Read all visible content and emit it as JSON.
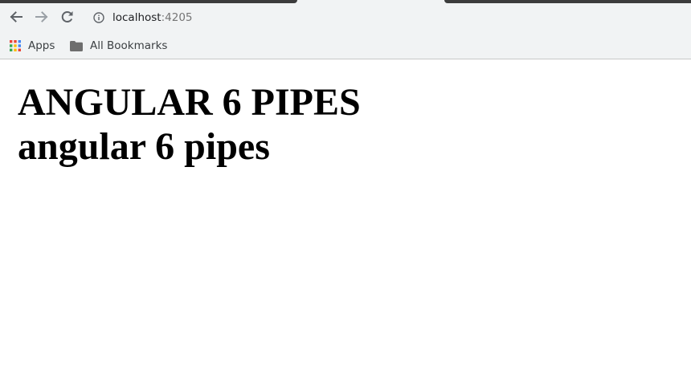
{
  "browser": {
    "url_host": "localhost",
    "url_port": ":4205",
    "bookmarks": {
      "apps_label": "Apps",
      "all_bookmarks_label": "All Bookmarks"
    }
  },
  "page": {
    "heading_upper": "ANGULAR 6 PIPES",
    "heading_lower": "angular 6 pipes"
  },
  "icons": {
    "back": "arrow-left-icon",
    "forward": "arrow-right-icon",
    "reload": "reload-icon",
    "site_info": "info-icon",
    "apps": "apps-grid-icon",
    "folder": "folder-icon"
  },
  "colors": {
    "toolbar_bg": "#f1f3f4",
    "tab_dark": "#3c3c3c",
    "text_main": "#202124",
    "port_text": "#757575"
  }
}
